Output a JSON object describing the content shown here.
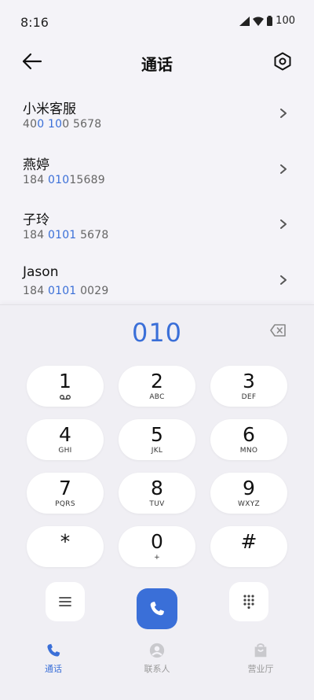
{
  "status_bar": {
    "time": "8:16",
    "battery": "100"
  },
  "header": {
    "title": "通话"
  },
  "contacts": [
    {
      "name": "小米客服",
      "num_pre": "40",
      "num_hl1": "0",
      "num_mid": " ",
      "num_hl2": "10",
      "num_post": "0 5678"
    },
    {
      "name": "燕婷",
      "num_pre": "184 ",
      "num_hl1": "010",
      "num_mid": "",
      "num_hl2": "",
      "num_post": "15689"
    },
    {
      "name": "子玲",
      "num_pre": "184 ",
      "num_hl1": "0101",
      "num_mid": "",
      "num_hl2": "",
      "num_post": " 5678"
    },
    {
      "name": "Jason",
      "num_pre": "184 ",
      "num_hl1": "0101",
      "num_mid": "",
      "num_hl2": "",
      "num_post": " 0029"
    }
  ],
  "dialer": {
    "input": "010",
    "keys": [
      {
        "digit": "1",
        "letters": "voicemail"
      },
      {
        "digit": "2",
        "letters": "ABC"
      },
      {
        "digit": "3",
        "letters": "DEF"
      },
      {
        "digit": "4",
        "letters": "GHI"
      },
      {
        "digit": "5",
        "letters": "JKL"
      },
      {
        "digit": "6",
        "letters": "MNO"
      },
      {
        "digit": "7",
        "letters": "PQRS"
      },
      {
        "digit": "8",
        "letters": "TUV"
      },
      {
        "digit": "9",
        "letters": "WXYZ"
      },
      {
        "digit": "*",
        "letters": ""
      },
      {
        "digit": "0",
        "letters": "+"
      },
      {
        "digit": "#",
        "letters": ""
      }
    ]
  },
  "tabs": [
    {
      "label": "通话",
      "icon": "phone-icon",
      "active": true
    },
    {
      "label": "联系人",
      "icon": "person-icon",
      "active": false
    },
    {
      "label": "营业厅",
      "icon": "bag-icon",
      "active": false
    }
  ],
  "colors": {
    "accent": "#3a6fd8",
    "background": "#f4f3f8"
  }
}
